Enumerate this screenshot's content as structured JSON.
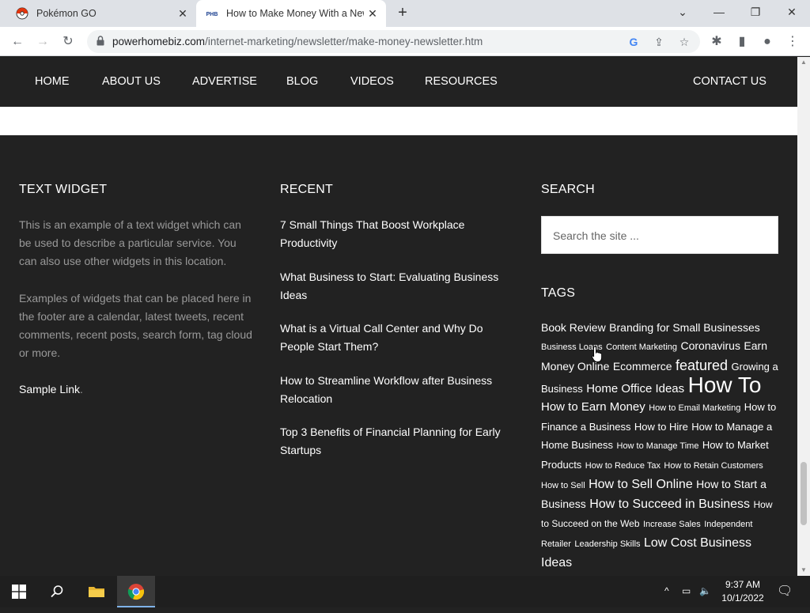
{
  "browser": {
    "tabs": [
      {
        "title": "Pokémon GO",
        "active": false
      },
      {
        "title": "How to Make Money With a Newsl",
        "active": true
      }
    ],
    "url_host": "powerhomebiz.com",
    "url_path": "/internet-marketing/newsletter/make-money-newsletter.htm"
  },
  "nav": {
    "items": [
      "HOME",
      "ABOUT US",
      "ADVERTISE",
      "BLOG",
      "VIDEOS",
      "RESOURCES"
    ],
    "contact": "CONTACT US"
  },
  "text_widget": {
    "heading": "TEXT WIDGET",
    "para1": "This is an example of a text widget which can be used to describe a particular service. You can also use other widgets in this location.",
    "para2": "Examples of widgets that can be placed here in the footer are a calendar, latest tweets, recent comments, recent posts, search form, tag cloud or more.",
    "sample_link": "Sample Link",
    "sample_suffix": "."
  },
  "recent": {
    "heading": "RECENT",
    "posts": [
      "7 Small Things That Boost Workplace Productivity",
      "What Business to Start: Evaluating Business Ideas",
      "What is a Virtual Call Center and Why Do People Start Them?",
      "How to Streamline Workflow after Business Relocation",
      "Top 3 Benefits of Financial Planning for Early Startups"
    ]
  },
  "search": {
    "heading": "SEARCH",
    "placeholder": "Search the site ..."
  },
  "tags": {
    "heading": "TAGS",
    "items": [
      {
        "label": "Book Review",
        "size": 14
      },
      {
        "label": "Branding for Small Businesses",
        "size": 14
      },
      {
        "label": "Business Loans",
        "size": 11
      },
      {
        "label": "Content Marketing",
        "size": 11
      },
      {
        "label": "Coronavirus",
        "size": 14
      },
      {
        "label": "Earn Money Online",
        "size": 14
      },
      {
        "label": "Ecommerce",
        "size": 14
      },
      {
        "label": "featured",
        "size": 18
      },
      {
        "label": "Growing a Business",
        "size": 13
      },
      {
        "label": "Home Office Ideas",
        "size": 15
      },
      {
        "label": "How To",
        "size": 28
      },
      {
        "label": "How to Earn Money",
        "size": 15
      },
      {
        "label": "How to Email Marketing",
        "size": 11
      },
      {
        "label": "How to Finance a Business",
        "size": 13
      },
      {
        "label": "How to Hire",
        "size": 13
      },
      {
        "label": "How to Manage a Home Business",
        "size": 13
      },
      {
        "label": "How to Manage Time",
        "size": 11
      },
      {
        "label": "How to Market Products",
        "size": 13
      },
      {
        "label": "How to Reduce Tax",
        "size": 11
      },
      {
        "label": "How to Retain Customers",
        "size": 11
      },
      {
        "label": "How to Sell",
        "size": 11
      },
      {
        "label": "How to Sell Online",
        "size": 16
      },
      {
        "label": "How to Start a Business",
        "size": 14
      },
      {
        "label": "How to Succeed in Business",
        "size": 16
      },
      {
        "label": "How to Succeed on the Web",
        "size": 12
      },
      {
        "label": "Increase Sales",
        "size": 11
      },
      {
        "label": "Independent Retailer",
        "size": 11
      },
      {
        "label": "Leadership Skills",
        "size": 11
      },
      {
        "label": "Low Cost Business Ideas",
        "size": 16
      }
    ]
  },
  "taskbar": {
    "time": "9:37 AM",
    "date": "10/1/2022"
  }
}
